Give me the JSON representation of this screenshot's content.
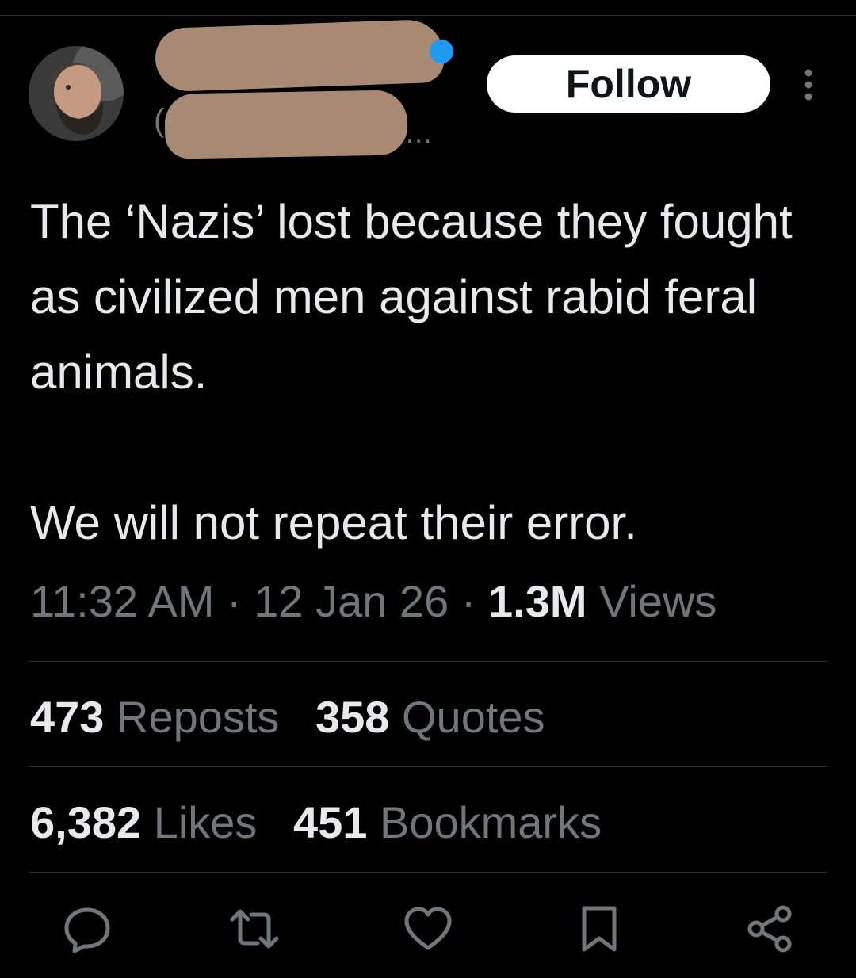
{
  "header": {
    "handle_partial": "(",
    "handle_truncation": "...",
    "follow_label": "Follow",
    "verified_color": "#1d9bf0",
    "redaction_color": "#a88a74"
  },
  "tweet": {
    "paragraphs": [
      "The ‘Nazis’ lost because they fought as civilized men against rabid feral animals.",
      "We will not repeat their error."
    ]
  },
  "meta": {
    "time": "11:32 AM",
    "separator": "·",
    "date": "12 Jan 26",
    "views_count": "1.3M",
    "views_label": "Views"
  },
  "stats": {
    "reposts": {
      "count": "473",
      "label": "Reposts"
    },
    "quotes": {
      "count": "358",
      "label": "Quotes"
    },
    "likes": {
      "count": "6,382",
      "label": "Likes"
    },
    "bookmarks": {
      "count": "451",
      "label": "Bookmarks"
    }
  },
  "actions": [
    "reply-icon",
    "repost-icon",
    "like-icon",
    "bookmark-icon",
    "share-icon"
  ],
  "colors": {
    "background": "#000000",
    "text": "#e7e9ea",
    "muted": "#71767b",
    "divider": "#2f3336"
  }
}
